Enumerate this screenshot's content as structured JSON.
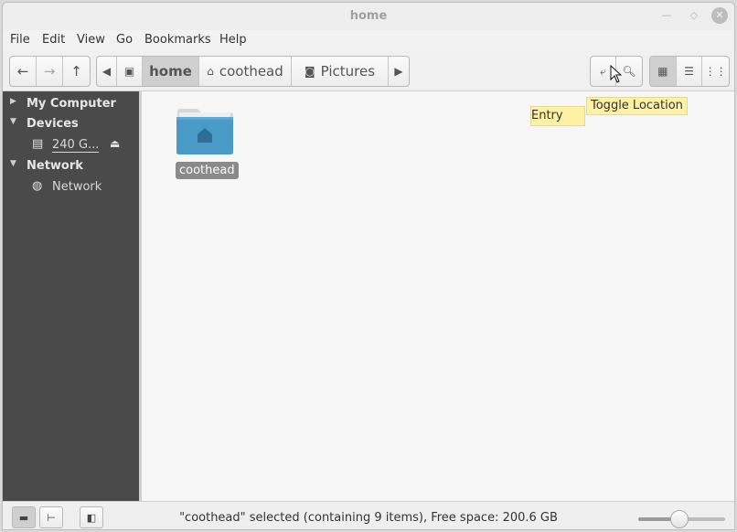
{
  "window": {
    "title": "home"
  },
  "menu": [
    "File",
    "Edit",
    "View",
    "Go",
    "Bookmarks",
    "Help"
  ],
  "breadcrumbs": [
    {
      "label": "home",
      "active": true
    },
    {
      "label": "coothead",
      "icon": "home-icon"
    },
    {
      "label": "Pictures",
      "icon": "camera-icon"
    }
  ],
  "tooltip": {
    "line1": "Toggle Location",
    "line2": "Entry"
  },
  "sidebar": {
    "sections": [
      {
        "label": "My Computer",
        "expanded": false
      },
      {
        "label": "Devices",
        "expanded": true,
        "items": [
          {
            "label": "240 G...",
            "icon": "drive-icon",
            "eject": true
          }
        ]
      },
      {
        "label": "Network",
        "expanded": true,
        "items": [
          {
            "label": "Network",
            "icon": "globe-icon"
          }
        ]
      }
    ]
  },
  "files": [
    {
      "name": "coothead",
      "type": "folder",
      "selected": true
    }
  ],
  "status": {
    "text": "\"coothead\" selected (containing 9 items), Free space: 200.6 GB"
  },
  "zoom": {
    "level_fraction": 0.45
  },
  "colors": {
    "sidebar_bg": "#4a4a4a",
    "folder": "#4a9ac8",
    "tooltip_bg": "#fdf1a6"
  }
}
